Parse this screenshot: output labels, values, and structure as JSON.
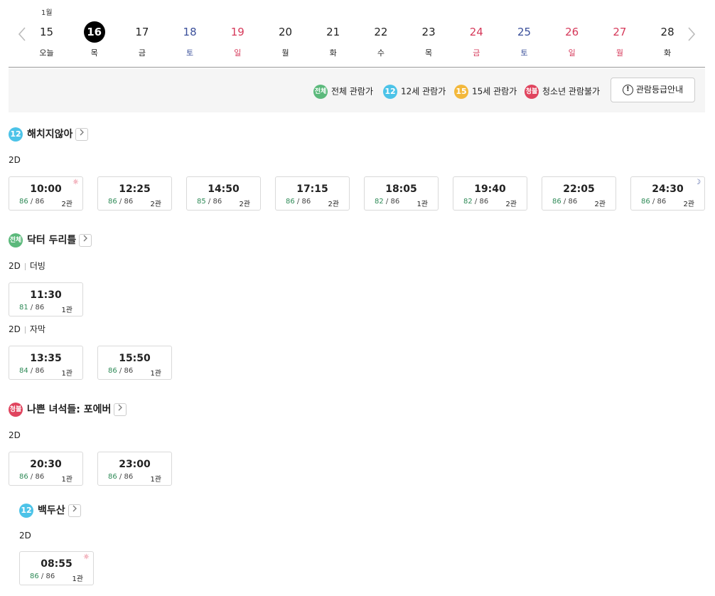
{
  "date_strip": {
    "month": "1월",
    "prev_label": "이전",
    "next_label": "다음",
    "days": [
      {
        "date": "15",
        "weekday": "오늘",
        "type": "weekday",
        "selected": false
      },
      {
        "date": "16",
        "weekday": "목",
        "type": "weekday",
        "selected": true
      },
      {
        "date": "17",
        "weekday": "금",
        "type": "weekday",
        "selected": false
      },
      {
        "date": "18",
        "weekday": "토",
        "type": "sat",
        "selected": false
      },
      {
        "date": "19",
        "weekday": "일",
        "type": "sun",
        "selected": false
      },
      {
        "date": "20",
        "weekday": "월",
        "type": "weekday",
        "selected": false
      },
      {
        "date": "21",
        "weekday": "화",
        "type": "weekday",
        "selected": false
      },
      {
        "date": "22",
        "weekday": "수",
        "type": "weekday",
        "selected": false
      },
      {
        "date": "23",
        "weekday": "목",
        "type": "weekday",
        "selected": false
      },
      {
        "date": "24",
        "weekday": "금",
        "type": "sun",
        "selected": false
      },
      {
        "date": "25",
        "weekday": "토",
        "type": "sat",
        "selected": false
      },
      {
        "date": "26",
        "weekday": "일",
        "type": "sun",
        "selected": false
      },
      {
        "date": "27",
        "weekday": "월",
        "type": "sun",
        "selected": false
      },
      {
        "date": "28",
        "weekday": "화",
        "type": "weekday",
        "selected": false
      }
    ]
  },
  "legend": {
    "items": [
      {
        "badge": "전체",
        "label": "전체 관람가",
        "color": "#5bb97b"
      },
      {
        "badge": "12",
        "label": "12세 관람가",
        "color": "#4cc3e8"
      },
      {
        "badge": "15",
        "label": "15세 관람가",
        "color": "#f3b83b"
      },
      {
        "badge": "청불",
        "label": "청소년 관람불가",
        "color": "#e0445e"
      }
    ],
    "guide_button": "관람등급안내"
  },
  "movies": [
    {
      "title": "해치지않아",
      "rating_badge": "12",
      "rating_color": "#4cc3e8",
      "formats": [
        {
          "format": "2D",
          "sub": "",
          "slots": [
            {
              "time": "10:00",
              "available": "86",
              "total": "86",
              "hall": "2관",
              "mark": "morning"
            },
            {
              "time": "12:25",
              "available": "86",
              "total": "86",
              "hall": "2관",
              "mark": ""
            },
            {
              "time": "14:50",
              "available": "85",
              "total": "86",
              "hall": "2관",
              "mark": ""
            },
            {
              "time": "17:15",
              "available": "86",
              "total": "86",
              "hall": "2관",
              "mark": ""
            },
            {
              "time": "18:05",
              "available": "82",
              "total": "86",
              "hall": "1관",
              "mark": ""
            },
            {
              "time": "19:40",
              "available": "82",
              "total": "86",
              "hall": "2관",
              "mark": ""
            },
            {
              "time": "22:05",
              "available": "86",
              "total": "86",
              "hall": "2관",
              "mark": ""
            },
            {
              "time": "24:30",
              "available": "86",
              "total": "86",
              "hall": "2관",
              "mark": "night"
            }
          ]
        }
      ]
    },
    {
      "title": "닥터 두리틀",
      "rating_badge": "전체",
      "rating_color": "#5bb97b",
      "formats": [
        {
          "format": "2D",
          "sub": "더빙",
          "slots": [
            {
              "time": "11:30",
              "available": "81",
              "total": "86",
              "hall": "1관",
              "mark": ""
            }
          ]
        },
        {
          "format": "2D",
          "sub": "자막",
          "slots": [
            {
              "time": "13:35",
              "available": "84",
              "total": "86",
              "hall": "1관",
              "mark": ""
            },
            {
              "time": "15:50",
              "available": "86",
              "total": "86",
              "hall": "1관",
              "mark": ""
            }
          ]
        }
      ]
    },
    {
      "title": "나쁜 녀석들: 포에버",
      "rating_badge": "청불",
      "rating_color": "#e0445e",
      "formats": [
        {
          "format": "2D",
          "sub": "",
          "slots": [
            {
              "time": "20:30",
              "available": "86",
              "total": "86",
              "hall": "1관",
              "mark": ""
            },
            {
              "time": "23:00",
              "available": "86",
              "total": "86",
              "hall": "1관",
              "mark": ""
            }
          ]
        }
      ]
    },
    {
      "title": "백두산",
      "rating_badge": "12",
      "rating_color": "#4cc3e8",
      "formats": [
        {
          "format": "2D",
          "sub": "",
          "slots": [
            {
              "time": "08:55",
              "available": "86",
              "total": "86",
              "hall": "1관",
              "mark": "morning"
            }
          ]
        }
      ]
    }
  ]
}
